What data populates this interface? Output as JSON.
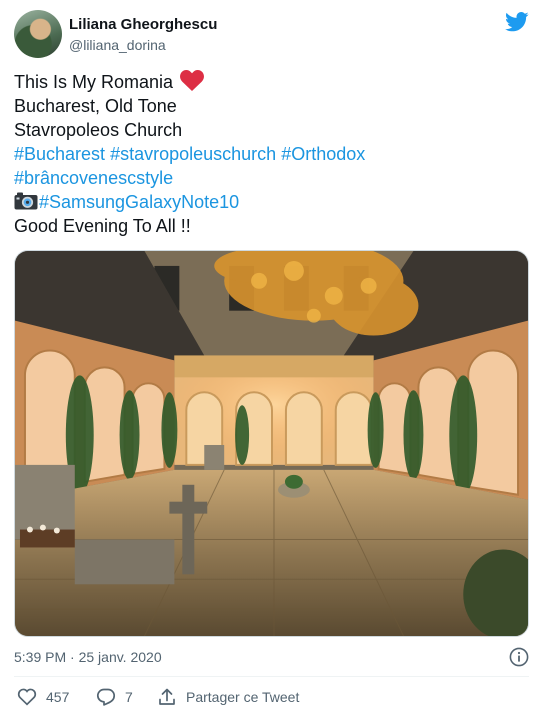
{
  "author": {
    "name": "Liliana Gheorghescu",
    "handle": "@liliana_dorina"
  },
  "tweet": {
    "line1": "This Is My Romania",
    "line2": "Bucharest, Old Tone",
    "line3": "Stavropoleos Church",
    "hashtags_line1": [
      "#Bucharest",
      "#stavropoleuschurch",
      "#Orthodox"
    ],
    "hashtags_line2": [
      "#brâncovenescstyle"
    ],
    "hashtag_device": "#SamsungGalaxyNote10",
    "line_last": "Good Evening To All !!"
  },
  "meta": {
    "timestamp": "5:39 PM · 25 janv. 2020"
  },
  "actions": {
    "likes": "457",
    "replies": "7",
    "share_label": "Partager ce Tweet"
  },
  "colors": {
    "hashtag": "#1b95e0",
    "twitter_blue": "#1d9bf0",
    "heart": "#e0245e",
    "muted": "#536471"
  },
  "icons": [
    "twitter-logo-icon",
    "heart-emoji-icon",
    "camera-emoji-icon",
    "info-icon",
    "heart-icon",
    "reply-icon",
    "share-icon"
  ]
}
